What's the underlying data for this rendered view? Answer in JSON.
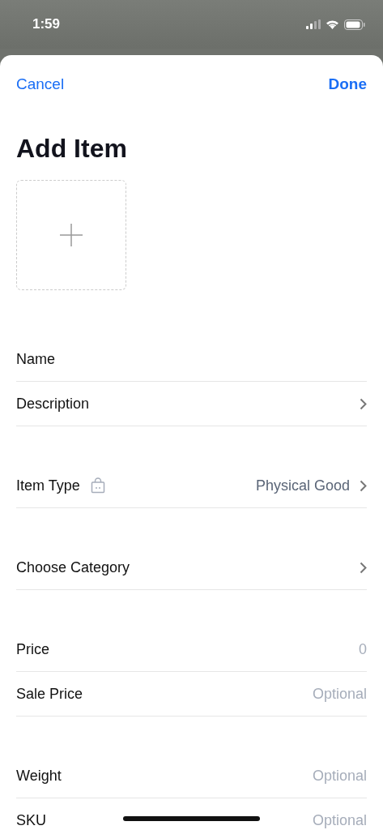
{
  "status_bar": {
    "time": "1:59"
  },
  "nav": {
    "cancel": "Cancel",
    "done": "Done"
  },
  "title": "Add Item",
  "groups": [
    {
      "rows": [
        {
          "kind": "input",
          "label": "Name"
        },
        {
          "kind": "link",
          "label": "Description"
        }
      ]
    },
    {
      "rows": [
        {
          "kind": "icon-link",
          "label": "Item Type",
          "value": "Physical Good"
        }
      ]
    },
    {
      "rows": [
        {
          "kind": "link",
          "label": "Choose Category"
        }
      ]
    },
    {
      "rows": [
        {
          "kind": "input",
          "label": "Price",
          "placeholder": "0"
        },
        {
          "kind": "input",
          "label": "Sale Price",
          "placeholder": "Optional"
        }
      ]
    },
    {
      "rows": [
        {
          "kind": "input",
          "label": "Weight",
          "placeholder": "Optional"
        },
        {
          "kind": "input",
          "label": "SKU",
          "placeholder": "Optional"
        }
      ]
    }
  ]
}
